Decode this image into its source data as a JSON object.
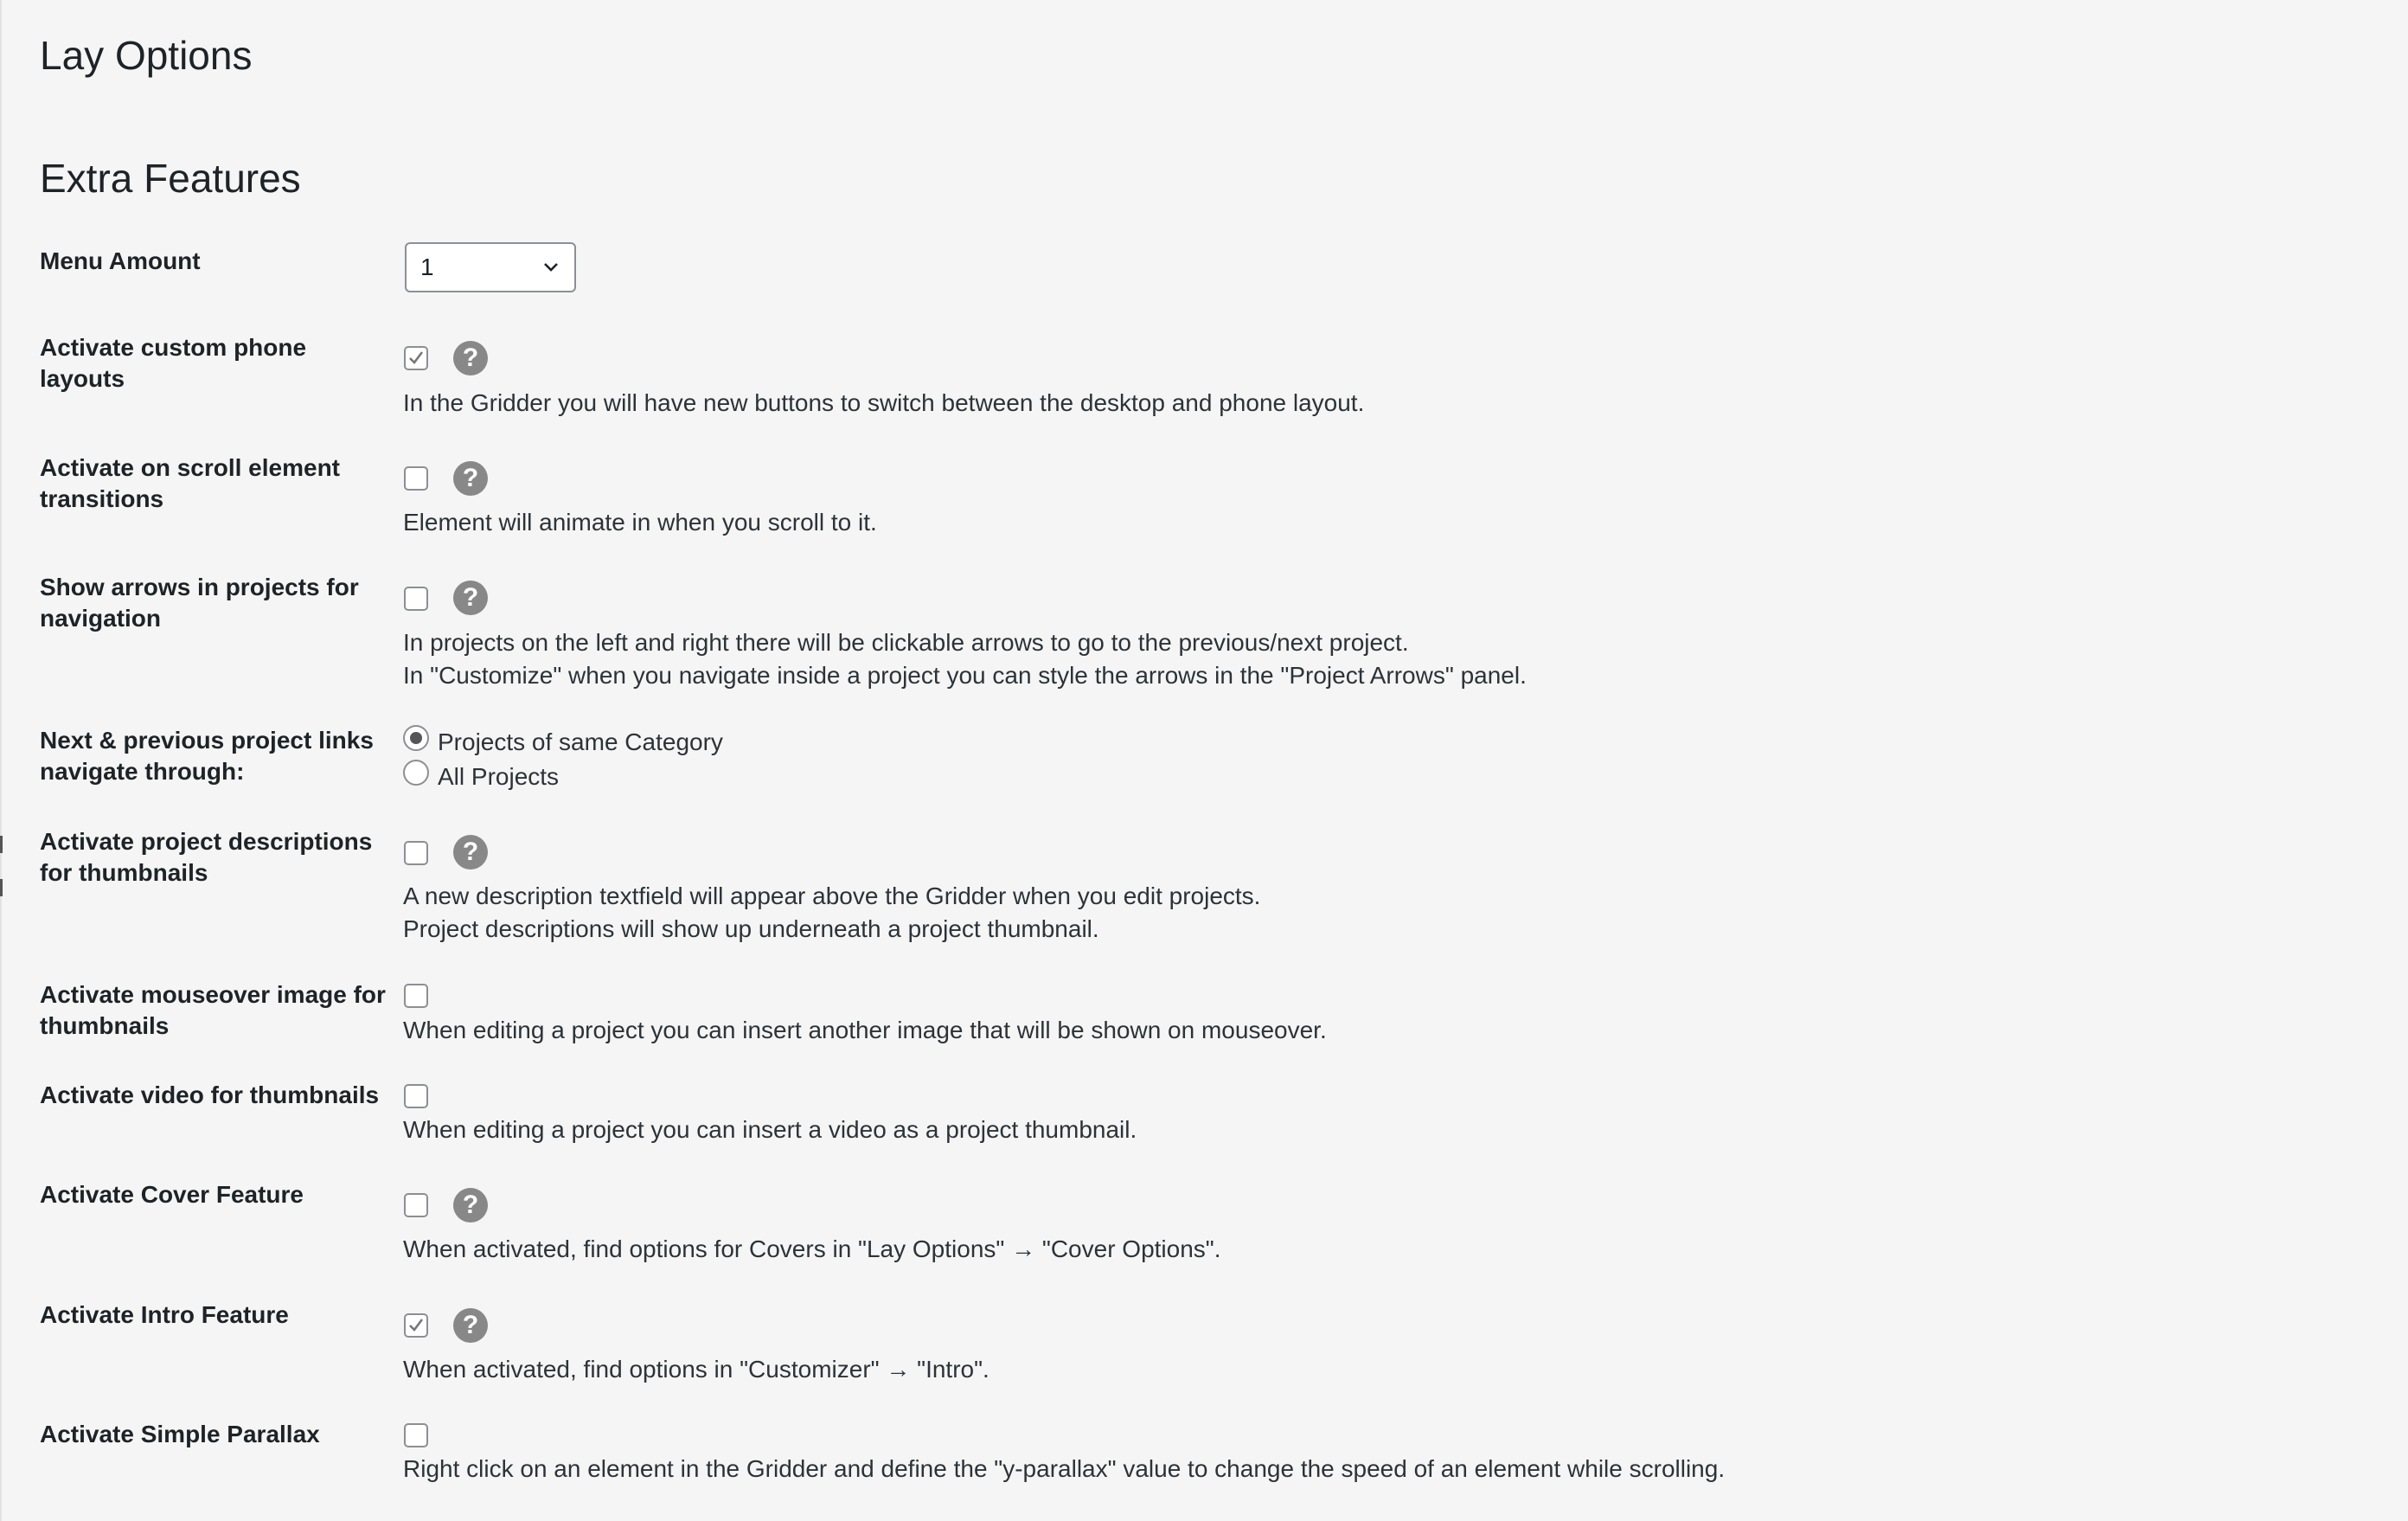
{
  "page": {
    "title": "Lay Options",
    "section": "Extra Features"
  },
  "menu_amount": {
    "label": "Menu Amount",
    "value": "1"
  },
  "settings": [
    {
      "label": "Activate custom phone layouts",
      "checked": true,
      "help_icon": "question-circle-icon",
      "desc": [
        "In the Gridder you will have new buttons to switch between the desktop and phone layout."
      ]
    },
    {
      "label": "Activate on scroll element transitions",
      "checked": false,
      "help_icon": "question-circle-icon",
      "desc": [
        "Element will animate in when you scroll to it."
      ]
    },
    {
      "label": "Show arrows in projects for navigation",
      "checked": false,
      "help_icon": "question-circle-icon",
      "desc": [
        "In projects on the left and right there will be clickable arrows to go to the previous/next project.",
        "In \"Customize\" when you navigate inside a project you can style the arrows in the \"Project Arrows\" panel."
      ]
    },
    {
      "label": "Activate project descriptions for thumbnails",
      "checked": false,
      "help_icon": "question-circle-icon",
      "desc": [
        "A new description textfield will appear above the Gridder when you edit projects.",
        "Project descriptions will show up underneath a project thumbnail."
      ]
    },
    {
      "label": "Activate mouseover image for thumbnails",
      "checked": false,
      "desc": [
        "When editing a project you can insert another image that will be shown on mouseover."
      ]
    },
    {
      "label": "Activate video for thumbnails",
      "checked": false,
      "desc": [
        "When editing a project you can insert a video as a project thumbnail."
      ]
    },
    {
      "label": "Activate Cover Feature",
      "checked": false,
      "help_icon": "question-circle-icon",
      "desc": [
        "When activated, find options for Covers in \"Lay Options\" → \"Cover Options\"."
      ]
    },
    {
      "label": "Activate Intro Feature",
      "checked": true,
      "help_icon": "question-circle-icon",
      "desc": [
        "When activated, find options in \"Customizer\" → \"Intro\"."
      ]
    },
    {
      "label": "Activate Simple Parallax",
      "checked": false,
      "desc": [
        "Right click on an element in the Gridder and define the \"y-parallax\" value to change the speed of an element while scrolling."
      ]
    }
  ],
  "nav_links": {
    "label": "Next & previous project links navigate through:",
    "options": [
      {
        "label": "Projects of same Category",
        "selected": true
      },
      {
        "label": "All Projects",
        "selected": false
      }
    ]
  },
  "help_glyph": "?",
  "colors": {
    "background": "#f5f5f5",
    "help_icon": "#888888",
    "text": "#1d2327"
  }
}
